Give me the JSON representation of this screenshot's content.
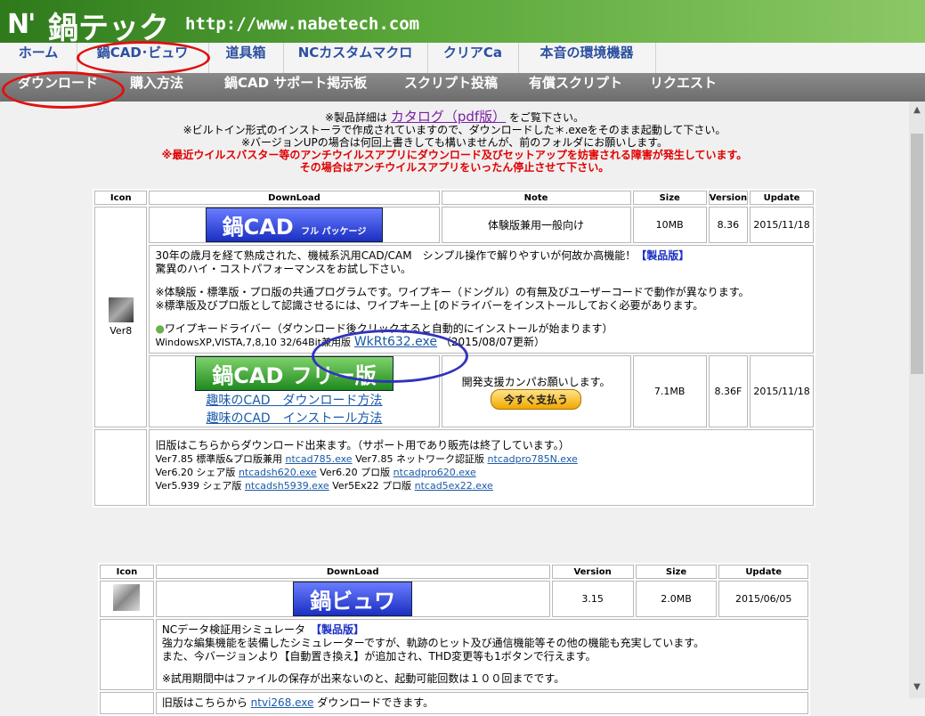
{
  "header": {
    "logo_mark": "N'",
    "logo_text": "鍋テック",
    "url": "http://www.nabetech.com"
  },
  "nav1": [
    "ホーム",
    "鍋CAD･ビュワ",
    "道具箱",
    "NCカスタムマクロ",
    "クリアCa",
    "本音の環境機器"
  ],
  "nav2": [
    "ダウンロード",
    "購入方法",
    "鍋CAD サポート掲示板",
    "スクリプト投稿",
    "有償スクリプト",
    "リクエスト"
  ],
  "notice": {
    "line1_pre": "※製品詳細は",
    "line1_link": "カタログ（pdf版）",
    "line1_post": "をご覧下さい。",
    "line2": "※ビルトイン形式のインストーラで作成されていますので、ダウンロードした＊.exeをそのまま起動して下さい。",
    "line3": "※バージョンUPの場合は何回上書きしても構いませんが、前のフォルダにお願いします。",
    "red1": "※最近ウイルスバスター等のアンチウイルスアプリにダウンロード及びセットアップを妨害される障害が発生しています。",
    "red2": "その場合はアンチウイルスアプリをいったん停止させて下さい。"
  },
  "table1": {
    "headers": [
      "Icon",
      "DownLoad",
      "Note",
      "Size",
      "Version",
      "Update"
    ],
    "ver_label": "Ver8",
    "row1": {
      "title": "鍋CAD",
      "title_sub": "フル パッケージ",
      "note": "体験版兼用一般向け",
      "size": "10MB",
      "version": "8.36",
      "update": "2015/11/18"
    },
    "desc": {
      "p1a": "30年の歳月を経て熟成された、機械系汎用CAD/CAM　シンプル操作で解りやすいが何故か高機能！",
      "p1b": "【製品版】",
      "p2": "驚異のハイ・コストパフォーマンスをお試し下さい。",
      "p3": "※体験版・標準版・プロ版の共通プログラムです。ワイプキー（ドングル）の有無及びユーザーコードで動作が異なります。",
      "p4": "※標準版及びプロ版として認識させるには、ワイプキー上 [のドライバーをインストールしておく必要があります。",
      "p5": "ワイプキードライバー（ダウンロード後クリックすると自動的にインストールが始まります）",
      "p6_pre": "WindowsXP,VISTA,7,8,10 32/64Bit兼用版",
      "p6_link": "WkRt632.exe",
      "p6_post": "（2015/08/07更新）"
    },
    "row2": {
      "title": "鍋CAD フリー版",
      "link1": "趣味のCAD　ダウンロード方法",
      "link2": "趣味のCAD　インストール方法",
      "note": "開発支援カンパお願いします。",
      "pay": "今すぐ支払う",
      "size": "7.1MB",
      "version": "8.36F",
      "update": "2015/11/18"
    },
    "old": {
      "intro": "旧版はこちらからダウンロード出来ます。（サポート用であり販売は終了しています。）",
      "l1_pre": "Ver7.85 標準版&プロ版兼用",
      "l1_link": "ntcad785.exe",
      "l1_mid": "Ver7.85 ネットワーク認証版",
      "l1_link2": "ntcadpro785N.exe",
      "l2_pre": "Ver6.20 シェア版",
      "l2_link": "ntcadsh620.exe",
      "l2_mid": "Ver6.20 プロ版",
      "l2_link2": "ntcadpro620.exe",
      "l3_pre": "Ver5.939 シェア版",
      "l3_link": "ntcadsh5939.exe",
      "l3_mid": "Ver5Ex22 プロ版",
      "l3_link2": "ntcad5ex22.exe"
    }
  },
  "table2": {
    "headers": [
      "Icon",
      "DownLoad",
      "Version",
      "Size",
      "Update"
    ],
    "row1": {
      "title": "鍋ビュワ",
      "version": "3.15",
      "size": "2.0MB",
      "update": "2015/06/05"
    },
    "desc": {
      "p1a": "NCデータ検証用シミュレータ",
      "p1b": "【製品版】",
      "p2": "強力な編集機能を装備したシミュレーターですが、軌跡のヒット及び通信機能等その他の機能も充実しています。",
      "p3": "また、今バージョンより【自動置き換え】が追加され、THD変更等も1ボタンで行えます。",
      "p4": "※試用期間中はファイルの保存が出来ないのと、起動可能回数は１００回までです。"
    },
    "old_pre": "旧版はこちらから",
    "old_link": "ntvi268.exe",
    "old_post": "ダウンロードできます。"
  },
  "colors": {
    "header_green": "#5aa83a",
    "nav_text": "#2b4fa0",
    "alert_red": "#e00000",
    "link_blue": "#1a5aa8"
  }
}
